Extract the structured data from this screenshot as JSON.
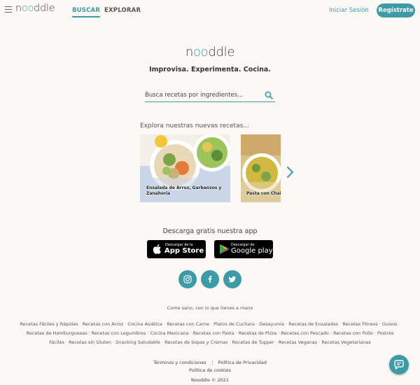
{
  "header": {
    "logo": {
      "pre": "n",
      "oo": "oo",
      "post": "ddle"
    },
    "tabs": [
      {
        "label": "BUSCAR",
        "active": true
      },
      {
        "label": "EXPLORAR",
        "active": false
      }
    ],
    "login_label": "Iniciar Sesión",
    "register_label": "Regístrate"
  },
  "hero": {
    "logo": {
      "pre": "n",
      "oo": "oo",
      "post": "ddle"
    },
    "tagline": "Improvisa. Experimenta. Cocina.",
    "search_placeholder": "Busca recetas por ingredientes..."
  },
  "explore": {
    "heading": "Explora nuestras nuevas recetas...",
    "cards": [
      {
        "title": "Ensalada de Arroz, Garbanzos y Zanahoria"
      },
      {
        "title": "Pasta con Chai"
      }
    ]
  },
  "app": {
    "heading": "Descarga gratis nuestra app",
    "appstore": {
      "small": "Descargar de la",
      "big": "App Store"
    },
    "googleplay": {
      "small": "Descargar de",
      "big": "Google play"
    }
  },
  "social": [
    "instagram-icon",
    "facebook-icon",
    "twitter-icon"
  ],
  "footer": {
    "motto": "Come sano, con lo que tienes a mano",
    "recipe_links": [
      "Recetas Fáciles y Rápidas",
      "Recetas con Arroz",
      "Cocina Asiática",
      "Recetas con Carne",
      "Platos de Cuchara",
      "Desayunos",
      "Recetas de Ensaladas",
      "Recetas Fitness",
      "Guisos",
      "Recetas de Hamburguesas",
      "Recetas con Legumbres",
      "Cocina Mexicana",
      "Recetas con Pasta",
      "Recetas de Pizza",
      "Recetas con Pescado",
      "Recetas con Pollo",
      "Postres Fáciles",
      "Recetas sin Gluten",
      "Snacking Saludable",
      "Recetas de Sopas y Cremas",
      "Recetas de Tupper",
      "Recetas Veganas",
      "Recetas Vegetarianas"
    ],
    "terms": "Términos y condiciones",
    "privacy": "Política de Privacidad",
    "cookies": "Política de cookies",
    "copyright": "Nooddle © 2021"
  },
  "colors": {
    "accent": "#3d9aa7",
    "background": "#fbf8f5"
  }
}
